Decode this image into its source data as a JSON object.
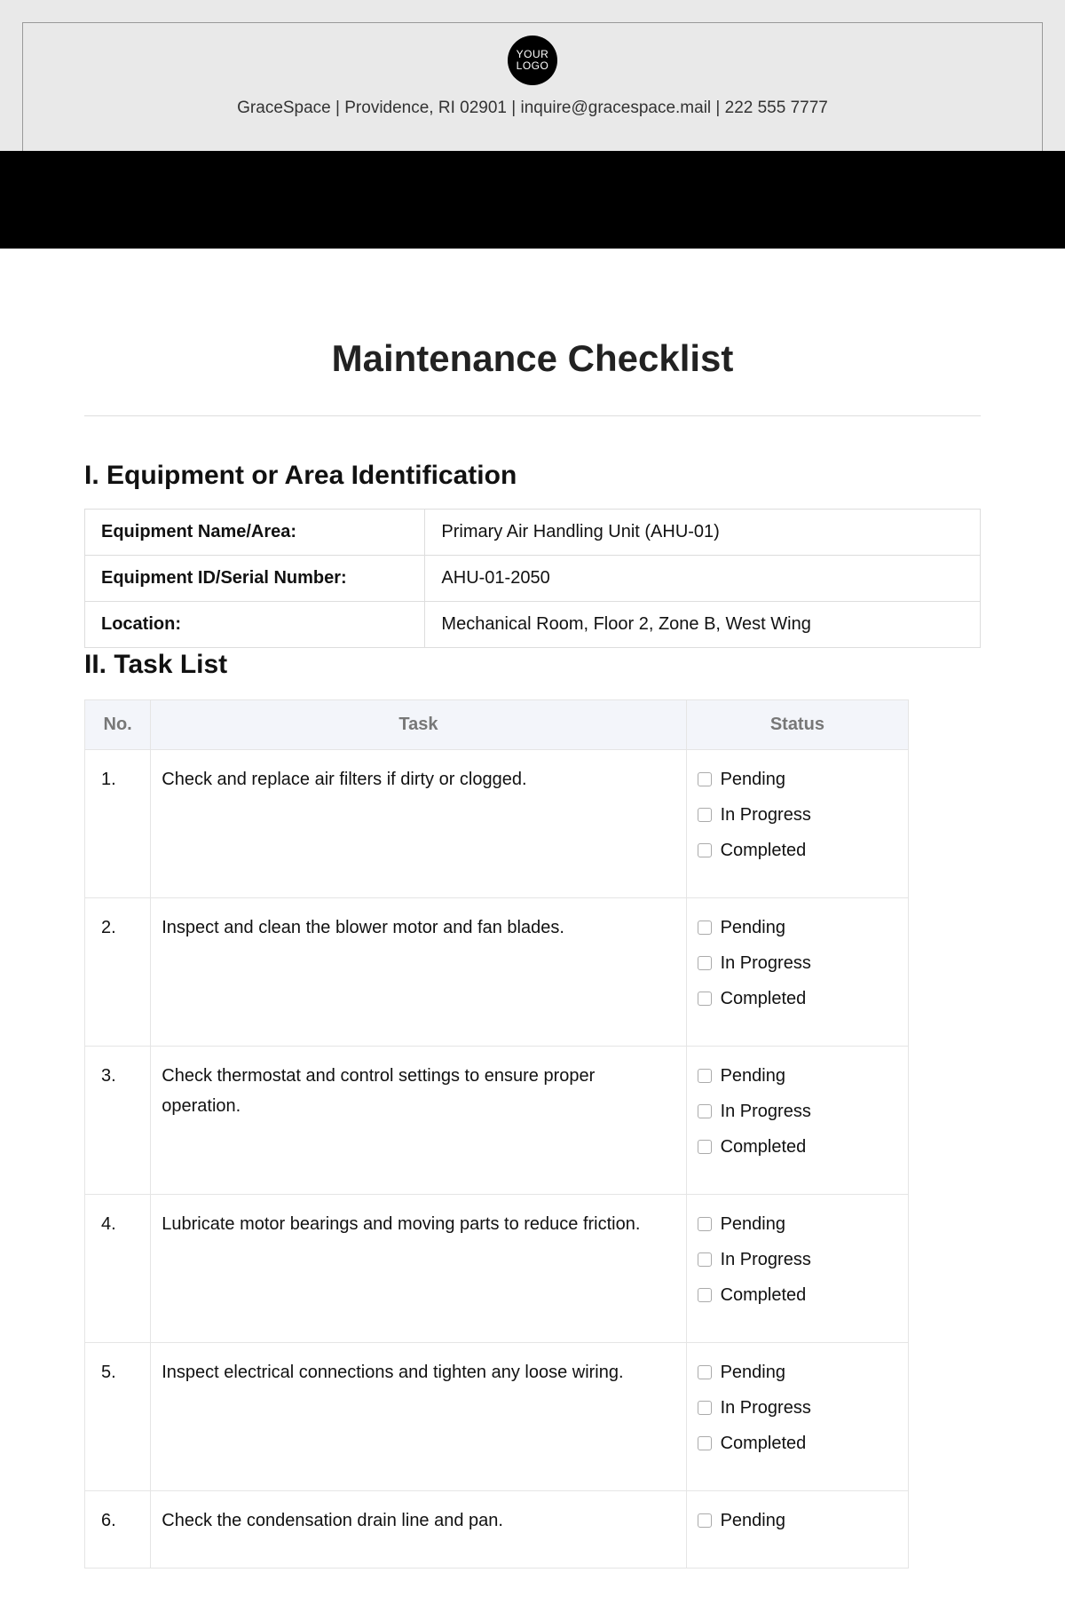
{
  "logo": {
    "line1": "YOUR",
    "line2": "LOGO"
  },
  "companyLine": "GraceSpace | Providence, RI 02901 | inquire@gracespace.mail | 222 555 7777",
  "pageTitle": "Maintenance Checklist",
  "sections": {
    "identification": {
      "heading": "I. Equipment or Area Identification",
      "rows": [
        {
          "label": "Equipment Name/Area:",
          "value": "Primary Air Handling Unit (AHU-01)"
        },
        {
          "label": "Equipment ID/Serial Number:",
          "value": "AHU-01-2050"
        },
        {
          "label": "Location:",
          "value": "Mechanical Room, Floor 2, Zone B, West Wing"
        }
      ]
    },
    "tasks": {
      "heading": "II. Task List",
      "columns": {
        "no": "No.",
        "task": "Task",
        "status": "Status"
      },
      "statusOptions": [
        "Pending",
        "In Progress",
        "Completed"
      ],
      "rows": [
        {
          "no": "1.",
          "task": "Check and replace air filters if dirty or clogged."
        },
        {
          "no": "2.",
          "task": "Inspect and clean the blower motor and fan blades."
        },
        {
          "no": "3.",
          "task": "Check thermostat and control settings to ensure proper operation."
        },
        {
          "no": "4.",
          "task": "Lubricate motor bearings and moving parts to reduce friction."
        },
        {
          "no": "5.",
          "task": "Inspect electrical connections and tighten any loose wiring."
        },
        {
          "no": "6.",
          "task": "Check the condensation drain line and pan."
        }
      ],
      "lastRowStatusesShown": [
        "Pending"
      ]
    }
  }
}
